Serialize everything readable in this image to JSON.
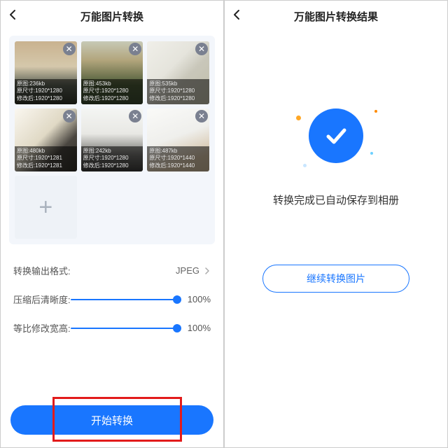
{
  "left": {
    "title": "万能图片转换",
    "thumbs": [
      {
        "size_line": "原图:236kb",
        "orig_line": "原尺寸:1920*1280",
        "mod_line": "修改后:1920*1280"
      },
      {
        "size_line": "原图:453kb",
        "orig_line": "原尺寸:1920*1280",
        "mod_line": "修改后:1920*1280"
      },
      {
        "size_line": "原图:535kb",
        "orig_line": "原尺寸:1920*1280",
        "mod_line": "修改后:1920*1280"
      },
      {
        "size_line": "原图:480kb",
        "orig_line": "原尺寸:1920*1281",
        "mod_line": "修改后:1920*1281"
      },
      {
        "size_line": "原图:242kb",
        "orig_line": "原尺寸:1920*1280",
        "mod_line": "修改后:1920*1280"
      },
      {
        "size_line": "原图:487kb",
        "orig_line": "原尺寸:1920*1440",
        "mod_line": "修改后:1920*1440"
      }
    ],
    "format_label": "转换输出格式:",
    "format_value": "JPEG",
    "clarity_label": "压缩后清晰度:",
    "clarity_value": "100%",
    "ratio_label": "等比修改宽高:",
    "ratio_value": "100%",
    "start_label": "开始转换"
  },
  "right": {
    "title": "万能图片转换结果",
    "message": "转换完成已自动保存到相册",
    "continue_label": "继续转换图片"
  }
}
